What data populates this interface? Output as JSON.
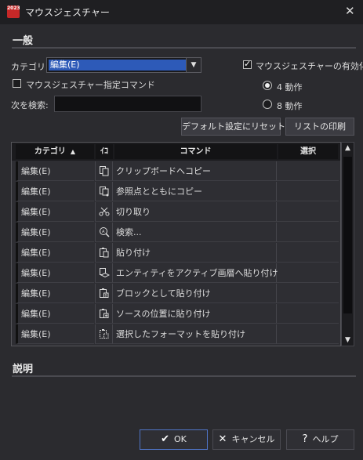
{
  "window": {
    "title": "マウスジェスチャー",
    "icon_badge": "2023",
    "close_glyph": "✕"
  },
  "general": {
    "section_title": "一般",
    "category_label": "カテゴリ:",
    "category_value": "編集(E)",
    "enable_label": "マウスジェスチャーの有効化",
    "enable_checked": true,
    "specify_label": "マウスジェスチャー指定コマンド",
    "specify_checked": false,
    "search_label": "次を検索:",
    "search_value": "",
    "radio_4_label": "4 動作",
    "radio_8_label": "8 動作",
    "radio_selected": "4",
    "reset_button": "デフォルト設定にリセット",
    "print_button": "リストの印刷"
  },
  "table": {
    "columns": {
      "category": "カテゴリ",
      "icon": "ｲｺ",
      "command": "コマンド",
      "select": "選択"
    },
    "sort_glyph": "▲",
    "rows": [
      {
        "category": "編集(E)",
        "icon": "copy-clipboard-icon",
        "command": "クリップボードへコピー",
        "select": ""
      },
      {
        "category": "編集(E)",
        "icon": "copy-with-base-point-icon",
        "command": "参照点とともにコピー",
        "select": ""
      },
      {
        "category": "編集(E)",
        "icon": "cut-scissors-icon",
        "command": "切り取り",
        "select": ""
      },
      {
        "category": "編集(E)",
        "icon": "search-magnifier-icon",
        "command": "検索...",
        "select": ""
      },
      {
        "category": "編集(E)",
        "icon": "paste-icon",
        "command": "貼り付け",
        "select": ""
      },
      {
        "category": "編集(E)",
        "icon": "paste-to-active-layer-icon",
        "command": "エンティティをアクティブ画層へ貼り付け",
        "select": ""
      },
      {
        "category": "編集(E)",
        "icon": "paste-as-block-icon",
        "command": "ブロックとして貼り付け",
        "select": ""
      },
      {
        "category": "編集(E)",
        "icon": "paste-to-original-coords-icon",
        "command": "ソースの位置に貼り付け",
        "select": ""
      },
      {
        "category": "編集(E)",
        "icon": "paste-special-icon",
        "command": "選択したフォーマットを貼り付け",
        "select": ""
      }
    ]
  },
  "description": {
    "section_title": "説明"
  },
  "footer": {
    "ok_label": "OK",
    "cancel_label": "キャンセル",
    "help_label": "ヘルプ"
  },
  "colors": {
    "background": "#2b2b2f",
    "selection": "#2d5ab8",
    "primary_border": "#4f73c4"
  }
}
